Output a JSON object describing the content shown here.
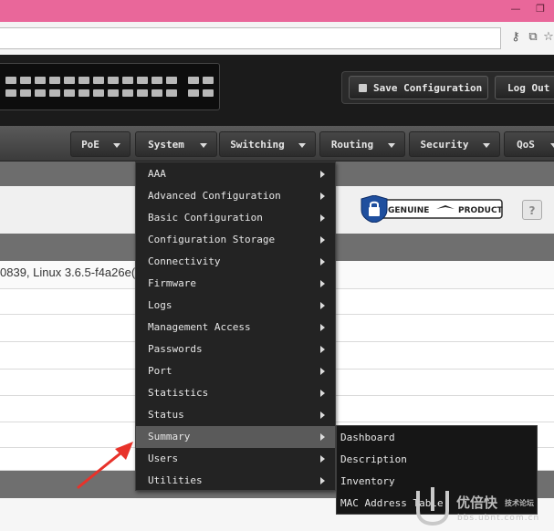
{
  "window": {
    "minimize_glyph": "—",
    "restore_glyph": "❐"
  },
  "addressbar": {
    "icons": [
      "key-icon",
      "translate-icon",
      "star-icon"
    ]
  },
  "header": {
    "save_label": "Save Configuration",
    "logout_label": "Log Out"
  },
  "nav": {
    "items": [
      {
        "label": "PoE"
      },
      {
        "label": "System"
      },
      {
        "label": "Switching"
      },
      {
        "label": "Routing"
      },
      {
        "label": "Security"
      },
      {
        "label": "QoS"
      }
    ]
  },
  "badge": {
    "left": "GENUINE",
    "right": "PRODUCT"
  },
  "help_label": "?",
  "content": {
    "row_text": "0839, Linux 3.6.5-f4a26e("
  },
  "system_menu": {
    "items": [
      {
        "label": "AAA"
      },
      {
        "label": "Advanced Configuration"
      },
      {
        "label": "Basic Configuration"
      },
      {
        "label": "Configuration Storage"
      },
      {
        "label": "Connectivity"
      },
      {
        "label": "Firmware"
      },
      {
        "label": "Logs"
      },
      {
        "label": "Management Access"
      },
      {
        "label": "Passwords"
      },
      {
        "label": "Port"
      },
      {
        "label": "Statistics"
      },
      {
        "label": "Status"
      },
      {
        "label": "Summary"
      },
      {
        "label": "Users"
      },
      {
        "label": "Utilities"
      }
    ],
    "active": "Summary"
  },
  "summary_submenu": {
    "items": [
      {
        "label": "Dashboard"
      },
      {
        "label": "Description"
      },
      {
        "label": "Inventory"
      },
      {
        "label": "MAC Address Table"
      }
    ]
  },
  "watermark": {
    "brand": "优倍快",
    "forum": "技术论坛",
    "url": "bbs.ubnt.com.cn"
  },
  "colors": {
    "titlebar": "#e9679a",
    "menu_bg": "#232323",
    "menu_active": "#5a5a5a",
    "annotation_arrow": "#e8322a",
    "badge_blue": "#1f4f9e"
  }
}
